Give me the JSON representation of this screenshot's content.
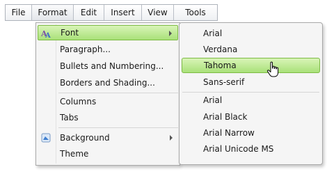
{
  "menubar": {
    "items": [
      {
        "label": "File",
        "active": false
      },
      {
        "label": "Format",
        "active": true
      },
      {
        "label": "Edit",
        "active": false
      },
      {
        "label": "Insert",
        "active": false
      },
      {
        "label": "View",
        "active": false
      },
      {
        "label": "Tools",
        "active": false
      }
    ]
  },
  "format_menu": {
    "items": [
      {
        "label": "Font",
        "icon": "font-icon",
        "submenu": true,
        "highlighted": true
      },
      {
        "label": "Paragraph..."
      },
      {
        "label": "Bullets and Numbering..."
      },
      {
        "label": "Borders and Shading..."
      },
      {
        "label": "Columns"
      },
      {
        "label": "Tabs"
      },
      {
        "label": "Background",
        "icon": "background-icon",
        "submenu": true
      },
      {
        "label": "Theme"
      }
    ]
  },
  "font_menu": {
    "items": [
      {
        "label": "Arial"
      },
      {
        "label": "Verdana"
      },
      {
        "label": "Tahoma",
        "highlighted": true
      },
      {
        "label": "Sans-serif"
      },
      {
        "label": "Arial"
      },
      {
        "label": "Arial Black"
      },
      {
        "label": "Arial Narrow"
      },
      {
        "label": "Arial Unicode MS"
      }
    ]
  },
  "colors": {
    "highlight_top": "#d9f4b8",
    "highlight_bottom": "#a9e179",
    "highlight_border": "#7dbb44",
    "menu_background": "#f5f5f5"
  },
  "cursor": {
    "icon": "hand-pointer-icon"
  }
}
